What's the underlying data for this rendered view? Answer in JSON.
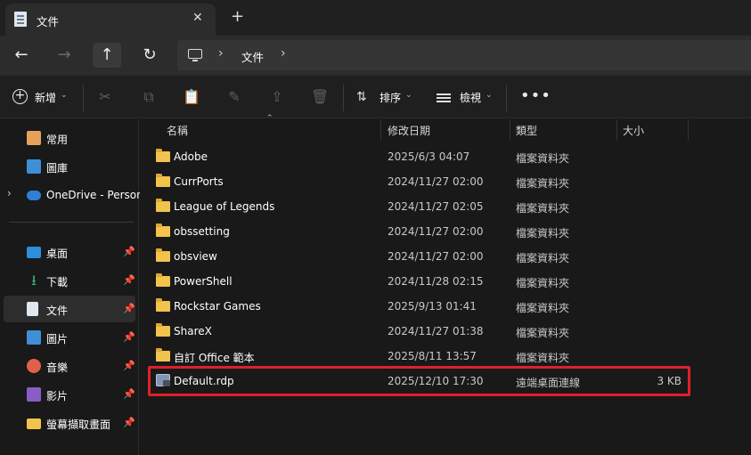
{
  "tab": {
    "title": "文件",
    "close": "✕",
    "new": "+"
  },
  "nav": {
    "back": "←",
    "forward": "→",
    "up": "↑",
    "refresh": "↻"
  },
  "address": {
    "sep": "›",
    "crumb": "文件"
  },
  "toolbar": {
    "new_label": "新增",
    "sort_label": "排序",
    "view_label": "檢視",
    "more": "•••",
    "chevron": "⌄"
  },
  "sidebar": {
    "items": [
      {
        "label": "常用",
        "icon": "home-icon",
        "pinned": false
      },
      {
        "label": "圖庫",
        "icon": "gallery-icon",
        "pinned": false
      },
      {
        "label": "OneDrive - Person",
        "icon": "cloud-icon",
        "pinned": false
      },
      {
        "label": "桌面",
        "icon": "desktop-icon",
        "pinned": true
      },
      {
        "label": "下載",
        "icon": "download-icon",
        "pinned": true
      },
      {
        "label": "文件",
        "icon": "document-icon",
        "pinned": true,
        "selected": true
      },
      {
        "label": "圖片",
        "icon": "picture-icon",
        "pinned": true
      },
      {
        "label": "音樂",
        "icon": "music-icon",
        "pinned": true
      },
      {
        "label": "影片",
        "icon": "video-icon",
        "pinned": true
      },
      {
        "label": "螢幕擷取畫面",
        "icon": "folder-icon",
        "pinned": true
      }
    ]
  },
  "columns": {
    "name": "名稱",
    "date": "修改日期",
    "type": "類型",
    "size": "大小"
  },
  "files": [
    {
      "name": "Adobe",
      "date": "2025/6/3 04:07",
      "type": "檔案資料夾",
      "size": "",
      "kind": "folder"
    },
    {
      "name": "CurrPorts",
      "date": "2024/11/27 02:00",
      "type": "檔案資料夾",
      "size": "",
      "kind": "folder"
    },
    {
      "name": "League of Legends",
      "date": "2024/11/27 02:05",
      "type": "檔案資料夾",
      "size": "",
      "kind": "folder"
    },
    {
      "name": "obssetting",
      "date": "2024/11/27 02:00",
      "type": "檔案資料夾",
      "size": "",
      "kind": "folder"
    },
    {
      "name": "obsview",
      "date": "2024/11/27 02:00",
      "type": "檔案資料夾",
      "size": "",
      "kind": "folder"
    },
    {
      "name": "PowerShell",
      "date": "2024/11/28 02:15",
      "type": "檔案資料夾",
      "size": "",
      "kind": "folder"
    },
    {
      "name": "Rockstar Games",
      "date": "2025/9/13 01:41",
      "type": "檔案資料夾",
      "size": "",
      "kind": "folder"
    },
    {
      "name": "ShareX",
      "date": "2024/11/27 01:38",
      "type": "檔案資料夾",
      "size": "",
      "kind": "folder"
    },
    {
      "name": "自訂 Office 範本",
      "date": "2025/8/11 13:57",
      "type": "檔案資料夾",
      "size": "",
      "kind": "folder"
    },
    {
      "name": "Default.rdp",
      "date": "2025/12/10 17:30",
      "type": "遠端桌面連線",
      "size": "3 KB",
      "kind": "rdp"
    }
  ],
  "colors": {
    "highlight": "#e0202a",
    "folder": "#f2c44e",
    "background": "#191919"
  }
}
